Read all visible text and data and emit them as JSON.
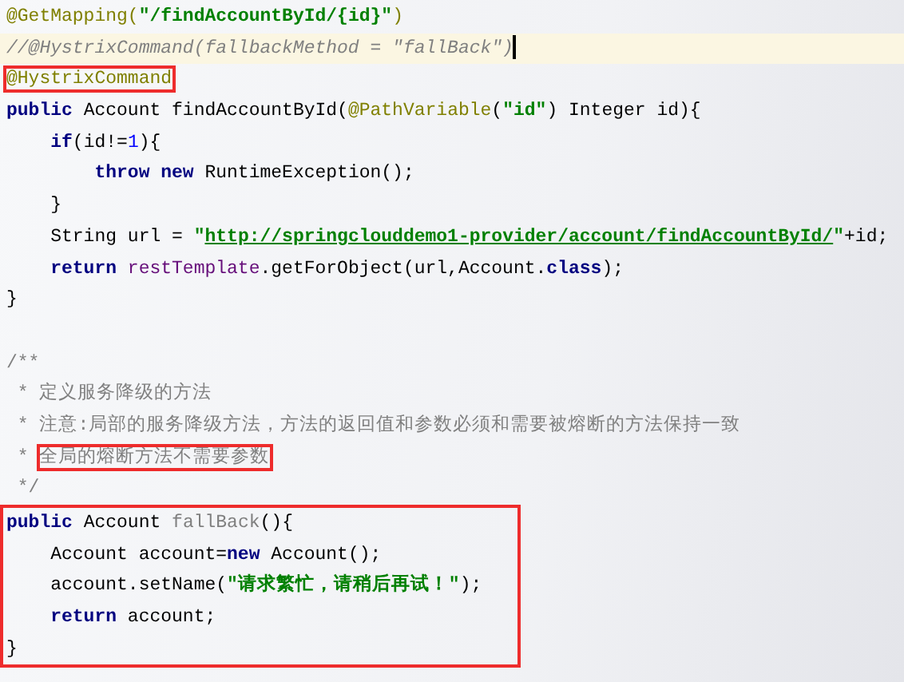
{
  "editor": {
    "blocks": [
      {
        "boxed": false,
        "lines": [
          {
            "current": false,
            "tokens": [
              {
                "kind": "annotation",
                "text": "@GetMapping("
              },
              {
                "kind": "string",
                "text": "\"/findAccountById/{id}\""
              },
              {
                "kind": "annotation",
                "text": ")"
              }
            ]
          },
          {
            "current": true,
            "tokens": [
              {
                "kind": "comment",
                "text": "//@HystrixCommand(fallbackMethod = \"fallBack\")"
              }
            ]
          },
          {
            "current": false,
            "tokens": [
              {
                "kind": "annotation",
                "text": "@HystrixCommand",
                "boxed": true
              }
            ]
          },
          {
            "current": false,
            "tokens": [
              {
                "kind": "keyword",
                "text": "public"
              },
              {
                "kind": "plain",
                "text": " Account findAccountById("
              },
              {
                "kind": "annotation",
                "text": "@PathVariable"
              },
              {
                "kind": "plain",
                "text": "("
              },
              {
                "kind": "string",
                "text": "\"id\""
              },
              {
                "kind": "plain",
                "text": ") Integer id){"
              }
            ]
          },
          {
            "current": false,
            "tokens": [
              {
                "kind": "keyword",
                "text": "    if"
              },
              {
                "kind": "plain",
                "text": "(id!="
              },
              {
                "kind": "number",
                "text": "1"
              },
              {
                "kind": "plain",
                "text": "){"
              }
            ]
          },
          {
            "current": false,
            "tokens": [
              {
                "kind": "keyword",
                "text": "        throw new"
              },
              {
                "kind": "plain",
                "text": " RuntimeException();"
              }
            ]
          },
          {
            "current": false,
            "tokens": [
              {
                "kind": "plain",
                "text": "    }"
              }
            ]
          },
          {
            "current": false,
            "tokens": [
              {
                "kind": "plain",
                "text": "    String url = "
              },
              {
                "kind": "string",
                "text": "\""
              },
              {
                "kind": "link",
                "text": "http://springclouddemo1-provider/account/findAccountById/"
              },
              {
                "kind": "string",
                "text": "\""
              },
              {
                "kind": "plain",
                "text": "+id;"
              }
            ]
          },
          {
            "current": false,
            "tokens": [
              {
                "kind": "keyword",
                "text": "    return"
              },
              {
                "kind": "field",
                "text": " restTemplate"
              },
              {
                "kind": "plain",
                "text": ".getForObject(url,Account."
              },
              {
                "kind": "keyword",
                "text": "class"
              },
              {
                "kind": "plain",
                "text": ");"
              }
            ]
          },
          {
            "current": false,
            "tokens": [
              {
                "kind": "plain",
                "text": "}"
              }
            ]
          },
          {
            "current": false
          },
          {
            "current": false,
            "tokens": [
              {
                "kind": "doc",
                "text": "/**"
              }
            ]
          },
          {
            "current": false,
            "tokens": [
              {
                "kind": "doc",
                "text": " * 定义服务降级的方法"
              }
            ]
          },
          {
            "current": false,
            "tokens": [
              {
                "kind": "doc",
                "text": " * 注意:局部的服务降级方法，方法的返回值和参数必须和需要被熔断的方法保持一致"
              }
            ]
          },
          {
            "current": false,
            "tokens": [
              {
                "kind": "doc",
                "text": " * "
              },
              {
                "kind": "doc",
                "text": "全局的熔断方法不需要参数",
                "boxed": true
              }
            ]
          },
          {
            "current": false,
            "tokens": [
              {
                "kind": "doc",
                "text": " */"
              }
            ]
          }
        ]
      },
      {
        "boxed": true,
        "lines": [
          {
            "current": false,
            "tokens": [
              {
                "kind": "keyword",
                "text": "public"
              },
              {
                "kind": "plain",
                "text": " Account "
              },
              {
                "kind": "unused",
                "text": "fallBack"
              },
              {
                "kind": "plain",
                "text": "(){"
              }
            ]
          },
          {
            "current": false,
            "tokens": [
              {
                "kind": "plain",
                "text": "    Account account="
              },
              {
                "kind": "keyword",
                "text": "new"
              },
              {
                "kind": "plain",
                "text": " Account();"
              }
            ]
          },
          {
            "current": false,
            "tokens": [
              {
                "kind": "plain",
                "text": "    account.setName("
              },
              {
                "kind": "string",
                "text": "\"请求繁忙，请稍后再试！\""
              },
              {
                "kind": "plain",
                "text": ");"
              }
            ]
          },
          {
            "current": false,
            "tokens": [
              {
                "kind": "keyword",
                "text": "    return"
              },
              {
                "kind": "plain",
                "text": " account;"
              }
            ]
          },
          {
            "current": false,
            "tokens": [
              {
                "kind": "plain",
                "text": "}"
              }
            ]
          }
        ]
      }
    ]
  }
}
